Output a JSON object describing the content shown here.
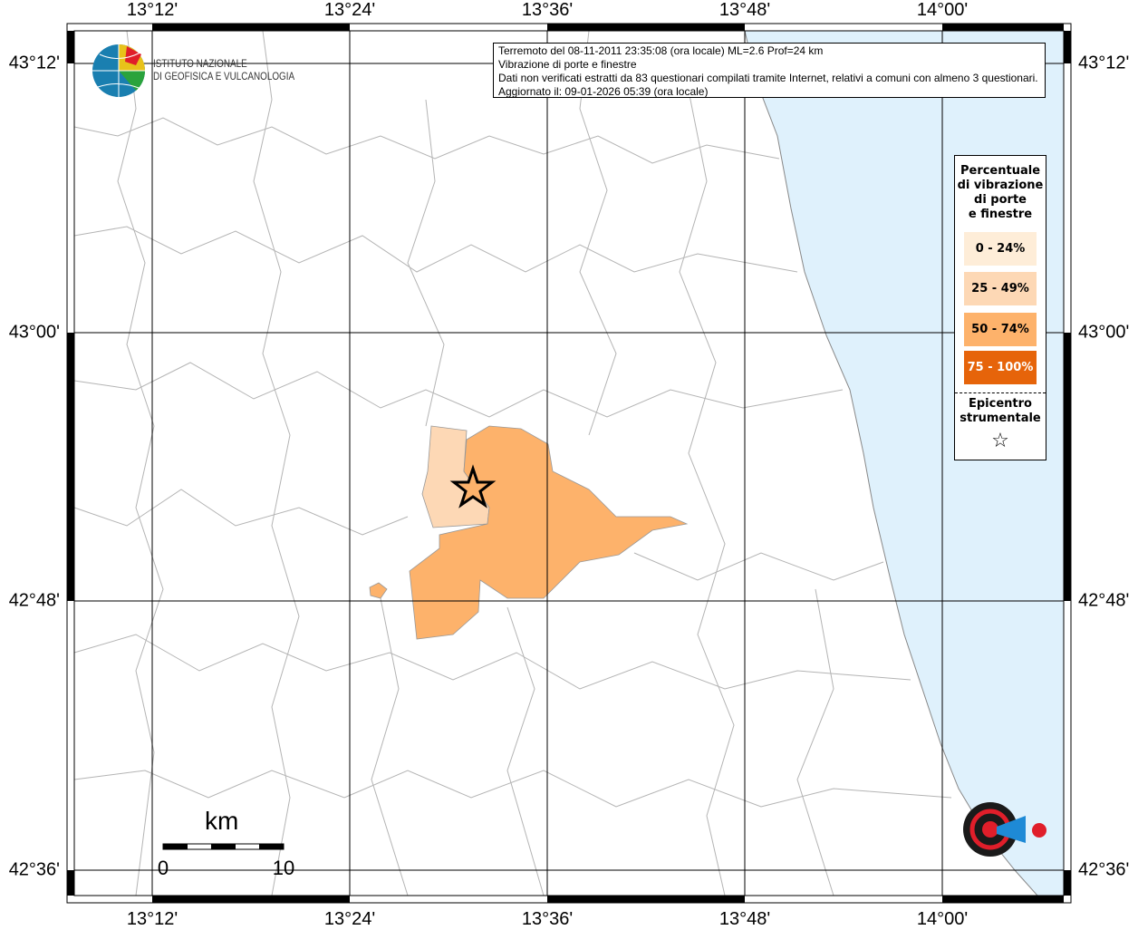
{
  "info_box": {
    "line1": "Terremoto del 08-11-2011 23:35:08 (ora locale) ML=2.6 Prof=24 km",
    "line2": "Vibrazione di porte e finestre",
    "line3": "Dati non verificati estratti da 83 questionari compilati tramite Internet, relativi a comuni con almeno 3 questionari.",
    "line4": "Aggiornato il: 09-01-2026 05:39 (ora locale)"
  },
  "axes": {
    "longitudes": [
      "13°12'",
      "13°24'",
      "13°36'",
      "13°48'",
      "14°00'"
    ],
    "latitudes": [
      "43°12'",
      "43°00'",
      "42°48'",
      "42°36'"
    ]
  },
  "legend": {
    "title": [
      "Percentuale",
      "di vibrazione",
      "di porte",
      "e finestre"
    ],
    "classes": [
      {
        "label": "0 - 24%",
        "color": "#feedd8"
      },
      {
        "label": "25 - 49%",
        "color": "#fdd8b5"
      },
      {
        "label": "50 - 74%",
        "color": "#fdb26b"
      },
      {
        "label": "75 - 100%",
        "color": "#e6640a"
      }
    ],
    "epicenter_label": [
      "Epicentro",
      "strumentale"
    ],
    "epicenter_icon": "star-outline-icon"
  },
  "scale_bar": {
    "unit": "km",
    "min": "0",
    "max": "10"
  },
  "logos": {
    "ingv": [
      "ISTITUTO NAZIONALE",
      "DI GEOFISICA E VULCANOLOGIA"
    ],
    "hsit": "www.haisentitoilterremoto.it"
  },
  "colors": {
    "sea": "#dff1fc",
    "boundary": "#b4b4b4",
    "grid": "#000000"
  }
}
